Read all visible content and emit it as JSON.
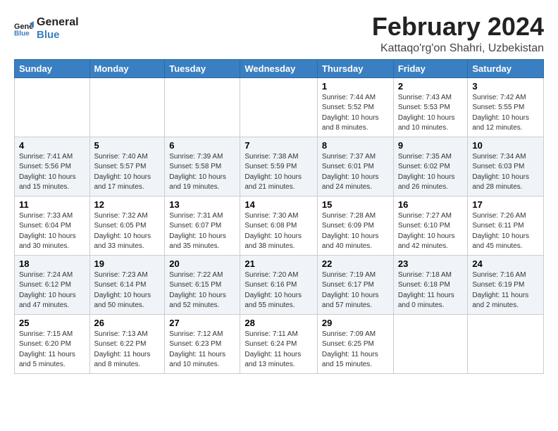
{
  "app": {
    "name_part1": "General",
    "name_part2": "Blue"
  },
  "title": "February 2024",
  "subtitle": "Kattaqo'rg'on Shahri, Uzbekistan",
  "headers": [
    "Sunday",
    "Monday",
    "Tuesday",
    "Wednesday",
    "Thursday",
    "Friday",
    "Saturday"
  ],
  "weeks": [
    [
      {
        "day": "",
        "info": ""
      },
      {
        "day": "",
        "info": ""
      },
      {
        "day": "",
        "info": ""
      },
      {
        "day": "",
        "info": ""
      },
      {
        "day": "1",
        "info": "Sunrise: 7:44 AM\nSunset: 5:52 PM\nDaylight: 10 hours\nand 8 minutes."
      },
      {
        "day": "2",
        "info": "Sunrise: 7:43 AM\nSunset: 5:53 PM\nDaylight: 10 hours\nand 10 minutes."
      },
      {
        "day": "3",
        "info": "Sunrise: 7:42 AM\nSunset: 5:55 PM\nDaylight: 10 hours\nand 12 minutes."
      }
    ],
    [
      {
        "day": "4",
        "info": "Sunrise: 7:41 AM\nSunset: 5:56 PM\nDaylight: 10 hours\nand 15 minutes."
      },
      {
        "day": "5",
        "info": "Sunrise: 7:40 AM\nSunset: 5:57 PM\nDaylight: 10 hours\nand 17 minutes."
      },
      {
        "day": "6",
        "info": "Sunrise: 7:39 AM\nSunset: 5:58 PM\nDaylight: 10 hours\nand 19 minutes."
      },
      {
        "day": "7",
        "info": "Sunrise: 7:38 AM\nSunset: 5:59 PM\nDaylight: 10 hours\nand 21 minutes."
      },
      {
        "day": "8",
        "info": "Sunrise: 7:37 AM\nSunset: 6:01 PM\nDaylight: 10 hours\nand 24 minutes."
      },
      {
        "day": "9",
        "info": "Sunrise: 7:35 AM\nSunset: 6:02 PM\nDaylight: 10 hours\nand 26 minutes."
      },
      {
        "day": "10",
        "info": "Sunrise: 7:34 AM\nSunset: 6:03 PM\nDaylight: 10 hours\nand 28 minutes."
      }
    ],
    [
      {
        "day": "11",
        "info": "Sunrise: 7:33 AM\nSunset: 6:04 PM\nDaylight: 10 hours\nand 30 minutes."
      },
      {
        "day": "12",
        "info": "Sunrise: 7:32 AM\nSunset: 6:05 PM\nDaylight: 10 hours\nand 33 minutes."
      },
      {
        "day": "13",
        "info": "Sunrise: 7:31 AM\nSunset: 6:07 PM\nDaylight: 10 hours\nand 35 minutes."
      },
      {
        "day": "14",
        "info": "Sunrise: 7:30 AM\nSunset: 6:08 PM\nDaylight: 10 hours\nand 38 minutes."
      },
      {
        "day": "15",
        "info": "Sunrise: 7:28 AM\nSunset: 6:09 PM\nDaylight: 10 hours\nand 40 minutes."
      },
      {
        "day": "16",
        "info": "Sunrise: 7:27 AM\nSunset: 6:10 PM\nDaylight: 10 hours\nand 42 minutes."
      },
      {
        "day": "17",
        "info": "Sunrise: 7:26 AM\nSunset: 6:11 PM\nDaylight: 10 hours\nand 45 minutes."
      }
    ],
    [
      {
        "day": "18",
        "info": "Sunrise: 7:24 AM\nSunset: 6:12 PM\nDaylight: 10 hours\nand 47 minutes."
      },
      {
        "day": "19",
        "info": "Sunrise: 7:23 AM\nSunset: 6:14 PM\nDaylight: 10 hours\nand 50 minutes."
      },
      {
        "day": "20",
        "info": "Sunrise: 7:22 AM\nSunset: 6:15 PM\nDaylight: 10 hours\nand 52 minutes."
      },
      {
        "day": "21",
        "info": "Sunrise: 7:20 AM\nSunset: 6:16 PM\nDaylight: 10 hours\nand 55 minutes."
      },
      {
        "day": "22",
        "info": "Sunrise: 7:19 AM\nSunset: 6:17 PM\nDaylight: 10 hours\nand 57 minutes."
      },
      {
        "day": "23",
        "info": "Sunrise: 7:18 AM\nSunset: 6:18 PM\nDaylight: 11 hours\nand 0 minutes."
      },
      {
        "day": "24",
        "info": "Sunrise: 7:16 AM\nSunset: 6:19 PM\nDaylight: 11 hours\nand 2 minutes."
      }
    ],
    [
      {
        "day": "25",
        "info": "Sunrise: 7:15 AM\nSunset: 6:20 PM\nDaylight: 11 hours\nand 5 minutes."
      },
      {
        "day": "26",
        "info": "Sunrise: 7:13 AM\nSunset: 6:22 PM\nDaylight: 11 hours\nand 8 minutes."
      },
      {
        "day": "27",
        "info": "Sunrise: 7:12 AM\nSunset: 6:23 PM\nDaylight: 11 hours\nand 10 minutes."
      },
      {
        "day": "28",
        "info": "Sunrise: 7:11 AM\nSunset: 6:24 PM\nDaylight: 11 hours\nand 13 minutes."
      },
      {
        "day": "29",
        "info": "Sunrise: 7:09 AM\nSunset: 6:25 PM\nDaylight: 11 hours\nand 15 minutes."
      },
      {
        "day": "",
        "info": ""
      },
      {
        "day": "",
        "info": ""
      }
    ]
  ]
}
